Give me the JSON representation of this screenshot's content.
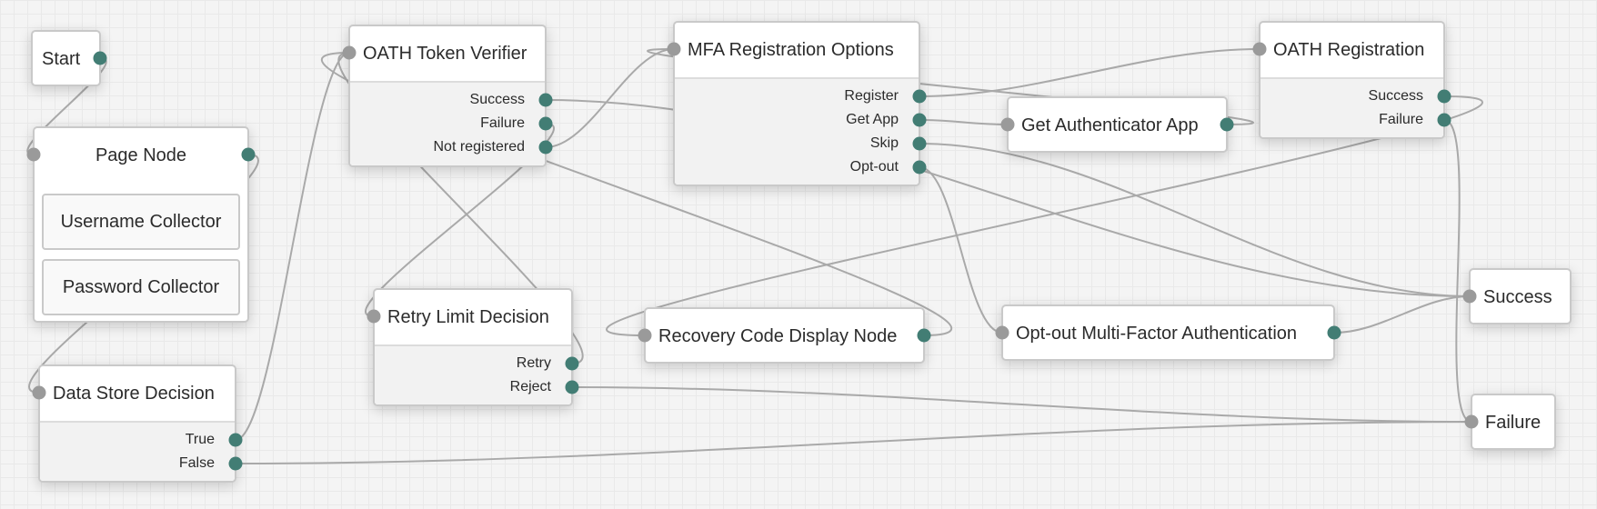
{
  "colors": {
    "output_port": "#427d74",
    "input_port": "#9a9a9a",
    "link": "#a9a9a9"
  },
  "nodes": [
    {
      "id": "start",
      "title": "Start",
      "has_input": false,
      "has_output": true,
      "outcomes": []
    },
    {
      "id": "page",
      "title": "Page Node",
      "has_input": true,
      "has_output": true,
      "outcomes": [],
      "children": [
        "Username Collector",
        "Password Collector"
      ]
    },
    {
      "id": "datastore",
      "title": "Data Store Decision",
      "has_input": true,
      "has_output": false,
      "outcomes": [
        "True",
        "False"
      ]
    },
    {
      "id": "oathverifier",
      "title": "OATH Token Verifier",
      "has_input": true,
      "has_output": false,
      "outcomes": [
        "Success",
        "Failure",
        "Not registered"
      ]
    },
    {
      "id": "mfaoptions",
      "title": "MFA Registration Options",
      "has_input": true,
      "has_output": false,
      "outcomes": [
        "Register",
        "Get App",
        "Skip",
        "Opt-out"
      ]
    },
    {
      "id": "getapp",
      "title": "Get Authenticator App",
      "has_input": true,
      "has_output": true,
      "outcomes": []
    },
    {
      "id": "oathreg",
      "title": "OATH Registration",
      "has_input": true,
      "has_output": false,
      "outcomes": [
        "Success",
        "Failure"
      ]
    },
    {
      "id": "retry",
      "title": "Retry Limit Decision",
      "has_input": true,
      "has_output": false,
      "outcomes": [
        "Retry",
        "Reject"
      ]
    },
    {
      "id": "recovery",
      "title": "Recovery Code Display Node",
      "has_input": true,
      "has_output": true,
      "outcomes": []
    },
    {
      "id": "optout",
      "title": "Opt-out Multi-Factor Authentication",
      "has_input": true,
      "has_output": true,
      "outcomes": []
    },
    {
      "id": "success",
      "title": "Success",
      "has_input": true,
      "has_output": false,
      "outcomes": []
    },
    {
      "id": "failure",
      "title": "Failure",
      "has_input": true,
      "has_output": false,
      "outcomes": []
    }
  ],
  "links": [
    {
      "from": "start",
      "outcome": null,
      "to": "page"
    },
    {
      "from": "page",
      "outcome": null,
      "to": "datastore"
    },
    {
      "from": "datastore",
      "outcome": "True",
      "to": "oathverifier"
    },
    {
      "from": "datastore",
      "outcome": "False",
      "to": "failure"
    },
    {
      "from": "oathverifier",
      "outcome": "Success",
      "to": "success"
    },
    {
      "from": "oathverifier",
      "outcome": "Failure",
      "to": "retry"
    },
    {
      "from": "oathverifier",
      "outcome": "Not registered",
      "to": "mfaoptions"
    },
    {
      "from": "mfaoptions",
      "outcome": "Register",
      "to": "oathreg"
    },
    {
      "from": "mfaoptions",
      "outcome": "Get App",
      "to": "getapp"
    },
    {
      "from": "mfaoptions",
      "outcome": "Skip",
      "to": "success"
    },
    {
      "from": "mfaoptions",
      "outcome": "Opt-out",
      "to": "optout"
    },
    {
      "from": "getapp",
      "outcome": null,
      "to": "mfaoptions"
    },
    {
      "from": "oathreg",
      "outcome": "Success",
      "to": "recovery"
    },
    {
      "from": "oathreg",
      "outcome": "Failure",
      "to": "failure"
    },
    {
      "from": "retry",
      "outcome": "Retry",
      "to": "oathverifier"
    },
    {
      "from": "retry",
      "outcome": "Reject",
      "to": "failure"
    },
    {
      "from": "recovery",
      "outcome": null,
      "to": "oathverifier"
    },
    {
      "from": "optout",
      "outcome": null,
      "to": "success"
    }
  ]
}
